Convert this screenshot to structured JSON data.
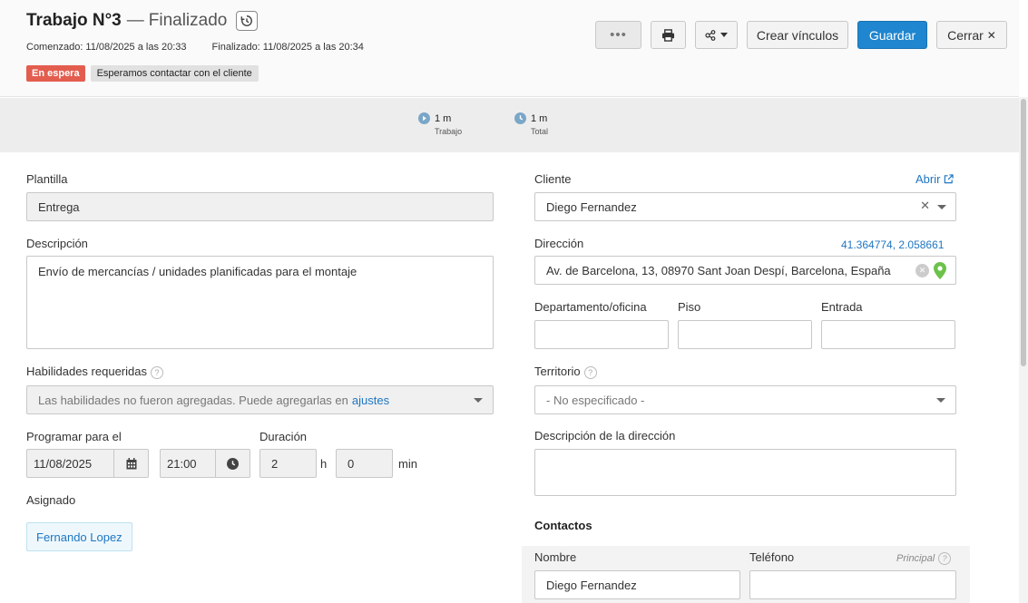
{
  "header": {
    "title": "Trabajo N°3",
    "separator": "—",
    "status": "Finalizado",
    "started": "Comenzado: 11/08/2025 a las 20:33",
    "finished": "Finalizado: 11/08/2025 a las 20:34",
    "tag_status": "En espera",
    "tag_note": "Esperamos contactar con el cliente"
  },
  "actions": {
    "more": "•••",
    "create_links": "Crear vínculos",
    "save": "Guardar",
    "close": "Cerrar",
    "close_symbol": "✕"
  },
  "stats": {
    "work_value": "1 m",
    "work_label": "Trabajo",
    "total_value": "1 m",
    "total_label": "Total"
  },
  "left": {
    "template_label": "Plantilla",
    "template_value": "Entrega",
    "description_label": "Descripción",
    "description_value": "Envío de mercancías / unidades planificadas para el montaje",
    "skills_label": "Habilidades requeridas",
    "skills_placeholder": "Las habilidades no fueron agregadas. Puede agregarlas en",
    "skills_link": "ajustes",
    "schedule_label": "Programar para el",
    "date_value": "11/08/2025",
    "time_value": "21:00",
    "duration_label": "Duración",
    "hours_value": "2",
    "hours_unit": "h",
    "minutes_value": "0",
    "minutes_unit": "min",
    "assigned_label": "Asignado",
    "assignee": "Fernando Lopez"
  },
  "right": {
    "client_label": "Cliente",
    "open_link": "Abrir",
    "client_value": "Diego Fernandez",
    "address_label": "Dirección",
    "coordinates": "41.364774, 2.058661",
    "address_value": "Av. de Barcelona, 13, 08970 Sant Joan Despí, Barcelona, España",
    "dept_label": "Departamento/oficina",
    "floor_label": "Piso",
    "entrance_label": "Entrada",
    "territory_label": "Territorio",
    "territory_value": "- No especificado -",
    "address_desc_label": "Descripción de la dirección",
    "contacts_title": "Contactos",
    "contact_name_label": "Nombre",
    "contact_phone_label": "Teléfono",
    "principal_label": "Principal",
    "contact_name_value": "Diego Fernandez"
  },
  "colors": {
    "primary": "#1f86cf",
    "danger_tag": "#e35d4f",
    "link": "#1f76c2",
    "map_pin": "#6cc24a"
  }
}
